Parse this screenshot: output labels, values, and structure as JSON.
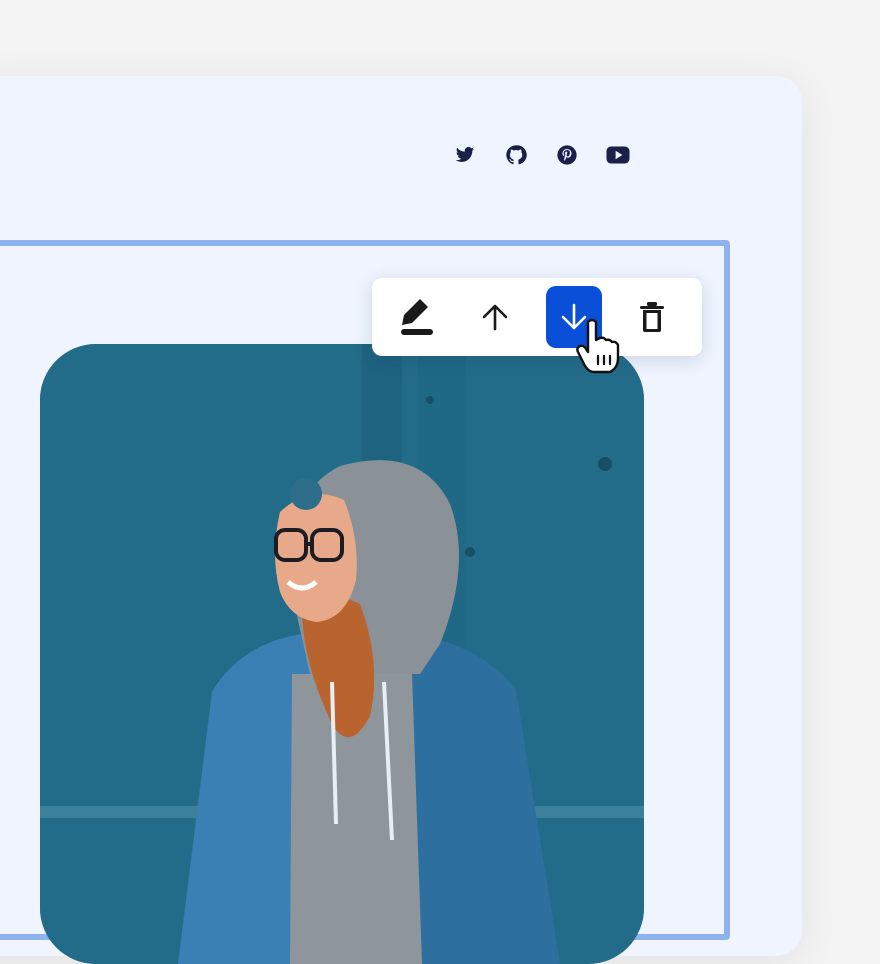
{
  "social": {
    "items": [
      {
        "icon": "twitter-icon"
      },
      {
        "icon": "github-icon"
      },
      {
        "icon": "pinterest-icon"
      },
      {
        "icon": "youtube-icon"
      }
    ],
    "color": "#1b1f4a"
  },
  "toolbar": {
    "buttons": [
      {
        "icon": "edit-icon"
      },
      {
        "icon": "move-up-icon"
      },
      {
        "icon": "move-down-icon",
        "active": true
      },
      {
        "icon": "delete-icon"
      }
    ],
    "active_color": "#0a4fd8"
  },
  "image": {
    "subject": "photo"
  },
  "colors": {
    "background": "#f3f3f4",
    "card": "#eff4fe",
    "selection_border": "#8db2ee"
  }
}
